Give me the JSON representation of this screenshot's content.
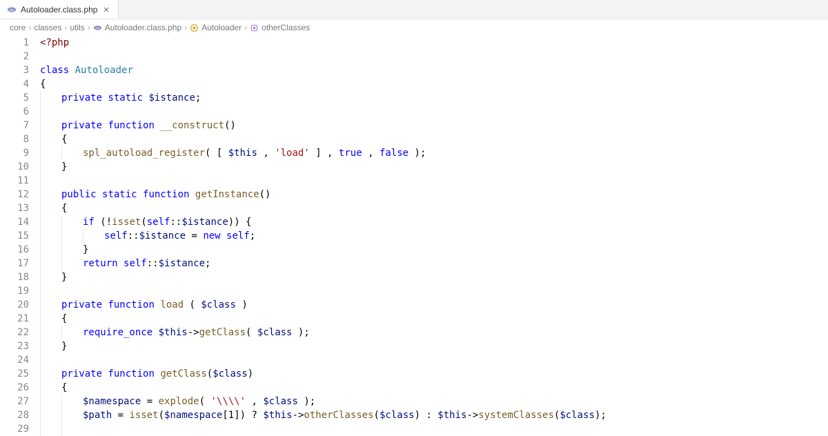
{
  "tab": {
    "label": "Autoloader.class.php",
    "icon": "php-icon"
  },
  "breadcrumb": [
    {
      "label": "core",
      "icon": null
    },
    {
      "label": "classes",
      "icon": null
    },
    {
      "label": "utils",
      "icon": null
    },
    {
      "label": "Autoloader.class.php",
      "icon": "php-icon"
    },
    {
      "label": "Autoloader",
      "icon": "class-icon"
    },
    {
      "label": "otherClasses",
      "icon": "method-icon"
    }
  ],
  "lines": [
    {
      "n": 1,
      "indent": 0,
      "tokens": [
        [
          "php-open",
          "<?php"
        ]
      ]
    },
    {
      "n": 2,
      "indent": 0,
      "tokens": []
    },
    {
      "n": 3,
      "indent": 0,
      "tokens": [
        [
          "k",
          "class"
        ],
        [
          "pun",
          " "
        ],
        [
          "cls",
          "Autoloader"
        ]
      ]
    },
    {
      "n": 4,
      "indent": 0,
      "tokens": [
        [
          "pun",
          "{"
        ]
      ]
    },
    {
      "n": 5,
      "indent": 1,
      "tokens": [
        [
          "k",
          "private"
        ],
        [
          "pun",
          " "
        ],
        [
          "k",
          "static"
        ],
        [
          "pun",
          " "
        ],
        [
          "var",
          "$istance"
        ],
        [
          "pun",
          ";"
        ]
      ]
    },
    {
      "n": 6,
      "indent": 1,
      "tokens": []
    },
    {
      "n": 7,
      "indent": 1,
      "tokens": [
        [
          "k",
          "private"
        ],
        [
          "pun",
          " "
        ],
        [
          "k",
          "function"
        ],
        [
          "pun",
          " "
        ],
        [
          "fn",
          "__construct"
        ],
        [
          "pun",
          "()"
        ]
      ]
    },
    {
      "n": 8,
      "indent": 1,
      "tokens": [
        [
          "pun",
          "{"
        ]
      ]
    },
    {
      "n": 9,
      "indent": 2,
      "tokens": [
        [
          "fn",
          "spl_autoload_register"
        ],
        [
          "pun",
          "( [ "
        ],
        [
          "var",
          "$this"
        ],
        [
          "pun",
          " , "
        ],
        [
          "str",
          "'load'"
        ],
        [
          "pun",
          " ] , "
        ],
        [
          "bool",
          "true"
        ],
        [
          "pun",
          " , "
        ],
        [
          "bool",
          "false"
        ],
        [
          "pun",
          " );"
        ]
      ]
    },
    {
      "n": 10,
      "indent": 1,
      "tokens": [
        [
          "pun",
          "}"
        ]
      ]
    },
    {
      "n": 11,
      "indent": 1,
      "tokens": []
    },
    {
      "n": 12,
      "indent": 1,
      "tokens": [
        [
          "k",
          "public"
        ],
        [
          "pun",
          " "
        ],
        [
          "k",
          "static"
        ],
        [
          "pun",
          " "
        ],
        [
          "k",
          "function"
        ],
        [
          "pun",
          " "
        ],
        [
          "fn",
          "getInstance"
        ],
        [
          "pun",
          "()"
        ]
      ]
    },
    {
      "n": 13,
      "indent": 1,
      "tokens": [
        [
          "pun",
          "{"
        ]
      ]
    },
    {
      "n": 14,
      "indent": 2,
      "tokens": [
        [
          "k",
          "if"
        ],
        [
          "pun",
          " (!"
        ],
        [
          "fn",
          "isset"
        ],
        [
          "pun",
          "("
        ],
        [
          "k",
          "self"
        ],
        [
          "pun",
          "::"
        ],
        [
          "var",
          "$istance"
        ],
        [
          "pun",
          ")) {"
        ]
      ]
    },
    {
      "n": 15,
      "indent": 3,
      "tokens": [
        [
          "k",
          "self"
        ],
        [
          "pun",
          "::"
        ],
        [
          "var",
          "$istance"
        ],
        [
          "pun",
          " = "
        ],
        [
          "k",
          "new"
        ],
        [
          "pun",
          " "
        ],
        [
          "k",
          "self"
        ],
        [
          "pun",
          ";"
        ]
      ]
    },
    {
      "n": 16,
      "indent": 2,
      "tokens": [
        [
          "pun",
          "}"
        ]
      ]
    },
    {
      "n": 17,
      "indent": 2,
      "tokens": [
        [
          "k",
          "return"
        ],
        [
          "pun",
          " "
        ],
        [
          "k",
          "self"
        ],
        [
          "pun",
          "::"
        ],
        [
          "var",
          "$istance"
        ],
        [
          "pun",
          ";"
        ]
      ]
    },
    {
      "n": 18,
      "indent": 1,
      "tokens": [
        [
          "pun",
          "}"
        ]
      ]
    },
    {
      "n": 19,
      "indent": 1,
      "tokens": []
    },
    {
      "n": 20,
      "indent": 1,
      "tokens": [
        [
          "k",
          "private"
        ],
        [
          "pun",
          " "
        ],
        [
          "k",
          "function"
        ],
        [
          "pun",
          " "
        ],
        [
          "fn",
          "load"
        ],
        [
          "pun",
          " ( "
        ],
        [
          "var",
          "$class"
        ],
        [
          "pun",
          " )"
        ]
      ]
    },
    {
      "n": 21,
      "indent": 1,
      "tokens": [
        [
          "pun",
          "{"
        ]
      ]
    },
    {
      "n": 22,
      "indent": 2,
      "tokens": [
        [
          "k",
          "require_once"
        ],
        [
          "pun",
          " "
        ],
        [
          "var",
          "$this"
        ],
        [
          "pun",
          "->"
        ],
        [
          "fn",
          "getClass"
        ],
        [
          "pun",
          "( "
        ],
        [
          "var",
          "$class"
        ],
        [
          "pun",
          " );"
        ]
      ]
    },
    {
      "n": 23,
      "indent": 1,
      "tokens": [
        [
          "pun",
          "}"
        ]
      ]
    },
    {
      "n": 24,
      "indent": 1,
      "tokens": []
    },
    {
      "n": 25,
      "indent": 1,
      "tokens": [
        [
          "k",
          "private"
        ],
        [
          "pun",
          " "
        ],
        [
          "k",
          "function"
        ],
        [
          "pun",
          " "
        ],
        [
          "fn",
          "getClass"
        ],
        [
          "pun",
          "("
        ],
        [
          "var",
          "$class"
        ],
        [
          "pun",
          ")"
        ]
      ]
    },
    {
      "n": 26,
      "indent": 1,
      "tokens": [
        [
          "pun",
          "{"
        ]
      ]
    },
    {
      "n": 27,
      "indent": 2,
      "tokens": [
        [
          "var",
          "$namespace"
        ],
        [
          "pun",
          " = "
        ],
        [
          "fn",
          "explode"
        ],
        [
          "pun",
          "( "
        ],
        [
          "str",
          "'\\\\\\\\'"
        ],
        [
          "pun",
          " , "
        ],
        [
          "var",
          "$class"
        ],
        [
          "pun",
          " );"
        ]
      ]
    },
    {
      "n": 28,
      "indent": 2,
      "tokens": [
        [
          "var",
          "$path"
        ],
        [
          "pun",
          " = "
        ],
        [
          "fn",
          "isset"
        ],
        [
          "pun",
          "("
        ],
        [
          "var",
          "$namespace"
        ],
        [
          "pun",
          "["
        ],
        [
          "pun",
          "1"
        ],
        [
          "pun",
          "]) ? "
        ],
        [
          "var",
          "$this"
        ],
        [
          "pun",
          "->"
        ],
        [
          "fn",
          "otherClasses"
        ],
        [
          "pun",
          "("
        ],
        [
          "var",
          "$class"
        ],
        [
          "pun",
          ") : "
        ],
        [
          "var",
          "$this"
        ],
        [
          "pun",
          "->"
        ],
        [
          "fn",
          "systemClasses"
        ],
        [
          "pun",
          "("
        ],
        [
          "var",
          "$class"
        ],
        [
          "pun",
          ");"
        ]
      ]
    },
    {
      "n": 29,
      "indent": 2,
      "tokens": []
    }
  ]
}
